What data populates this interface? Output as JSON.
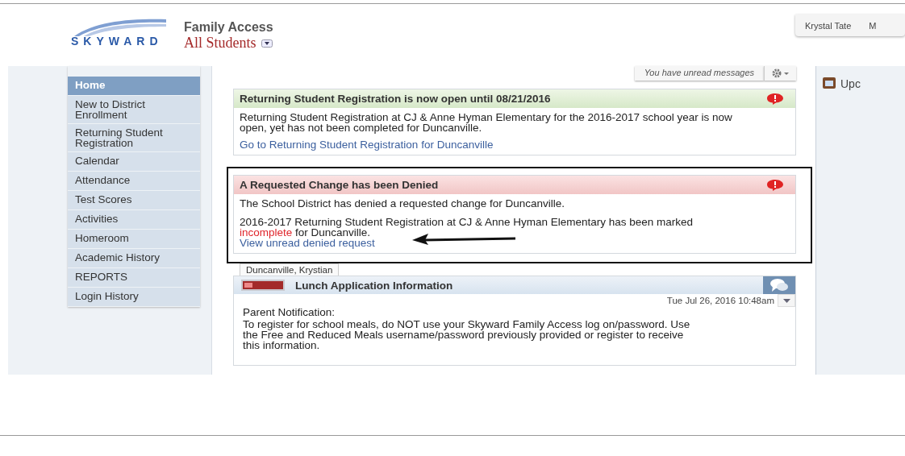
{
  "header": {
    "logo": "SKYWARD",
    "title": "Family Access",
    "student_selector": "All Students",
    "user_tabs": [
      {
        "label": "Krystal Tate"
      },
      {
        "label": "M"
      }
    ]
  },
  "toolbar": {
    "notice": "You have unread messages"
  },
  "sidebar": {
    "items": [
      {
        "label": "Home",
        "selected": true
      },
      {
        "label": "New to District Enrollment",
        "selected": false
      },
      {
        "label": "Returning Student Registration",
        "selected": false
      },
      {
        "label": "Calendar",
        "selected": false
      },
      {
        "label": "Attendance",
        "selected": false
      },
      {
        "label": "Test Scores",
        "selected": false
      },
      {
        "label": "Activities",
        "selected": false
      },
      {
        "label": "Homeroom",
        "selected": false
      },
      {
        "label": "Academic History",
        "selected": false
      },
      {
        "label": "REPORTS",
        "selected": false
      },
      {
        "label": "Login History",
        "selected": false
      }
    ]
  },
  "messages": [
    {
      "kind": "notice",
      "annotated": false,
      "title": "Returning Student Registration is now open until 08/21/2016",
      "paragraphs": [
        [
          {
            "text": "Returning Student Registration at CJ & Anne Hyman Elementary for the 2016-2017 school year is now open, yet has not been completed for Duncanville."
          }
        ]
      ],
      "link": "Go to Returning Student Registration for Duncanville"
    },
    {
      "kind": "denied",
      "annotated": true,
      "title": "A Requested Change has been Denied",
      "paragraphs": [
        [
          {
            "text": "The School District has denied a requested change for Duncanville."
          }
        ],
        [
          {
            "text": "2016-2017 Returning Student Registration at CJ & Anne Hyman Elementary has been marked "
          },
          {
            "text": "incomplete",
            "highlight": true
          },
          {
            "text": " for Duncanville."
          }
        ]
      ],
      "link": "View unread denied request"
    }
  ],
  "post": {
    "student_tab": "Duncanville, Krystian",
    "title": "Lunch Application Information",
    "timestamp": "Tue Jul 26, 2016 10:48am",
    "heading": "Parent Notification:",
    "body": "To register for school meals, do NOT use your Skyward Family Access log on/password. Use the Free and Reduced Meals username/password previously provided or register to receive this information."
  },
  "right_panel": {
    "title": "Upc"
  }
}
